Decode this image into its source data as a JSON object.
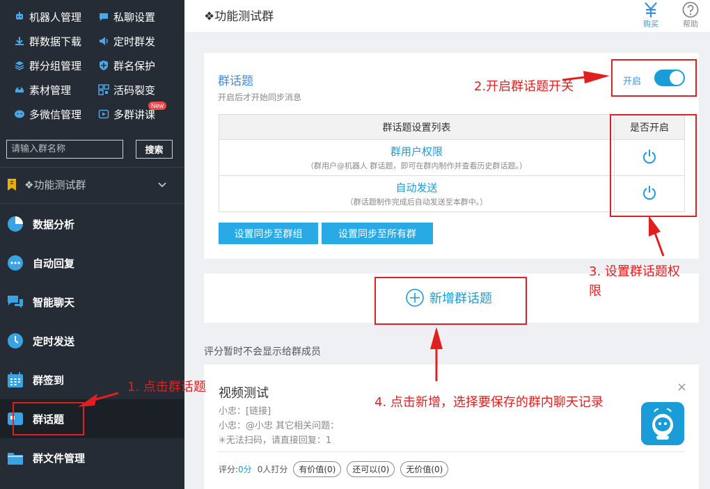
{
  "top_menu": {
    "items": [
      {
        "label": "机器人管理",
        "icon": "robot-icon"
      },
      {
        "label": "私聊设置",
        "icon": "chat-icon"
      },
      {
        "label": "群数据下载",
        "icon": "download-icon"
      },
      {
        "label": "定时群发",
        "icon": "broadcast-icon"
      },
      {
        "label": "群分组管理",
        "icon": "layers-icon"
      },
      {
        "label": "群名保护",
        "icon": "shield-icon"
      },
      {
        "label": "素材管理",
        "icon": "material-icon"
      },
      {
        "label": "活码裂变",
        "icon": "qrcode-icon"
      },
      {
        "label": "多微信管理",
        "icon": "wechat-icon"
      },
      {
        "label": "多群讲课",
        "icon": "play-icon"
      }
    ],
    "new_badge": "New"
  },
  "search": {
    "placeholder": "请输入群名称",
    "button": "搜索"
  },
  "group_selector": {
    "name": "❖功能测试群"
  },
  "nav": {
    "items": [
      {
        "label": "数据分析",
        "icon": "pie-chart-icon"
      },
      {
        "label": "自动回复",
        "icon": "message-dots-icon"
      },
      {
        "label": "智能聊天",
        "icon": "chat-bubbles-icon"
      },
      {
        "label": "定时发送",
        "icon": "clock-icon"
      },
      {
        "label": "群签到",
        "icon": "calendar-icon"
      },
      {
        "label": "群话题",
        "icon": "topic-icon"
      },
      {
        "label": "群文件管理",
        "icon": "folder-icon"
      }
    ],
    "active": "群话题"
  },
  "header": {
    "title": "❖功能测试群",
    "buy_label": "购买",
    "help_label": "帮助"
  },
  "topic_settings": {
    "title": "群话题",
    "subtitle": "开启后才开始同步消息",
    "toggle_label": "开启",
    "toggle_on": true,
    "table": {
      "col1": "群话题设置列表",
      "col2": "是否开启",
      "rows": [
        {
          "name": "群用户权限",
          "desc": "（群用户@机器人 群话题，即可在群内制作并查看历史群话题。）"
        },
        {
          "name": "自动发送",
          "desc": "（群话题制作完成后自动发送至本群中。）"
        }
      ]
    },
    "sync_group_btn": "设置同步至群组",
    "sync_all_btn": "设置同步至所有群"
  },
  "add_topic": {
    "label": "新增群话题"
  },
  "score_note": "评分暂时不会显示给群成员",
  "topic_card": {
    "title": "视频测试",
    "lines": [
      "小忠：[链接]",
      "小忠：@小忠 其它相关问题：",
      "✳无法扫码，请直接回复：1"
    ],
    "score_label": "评分:",
    "score_value": "0分",
    "raters": "0人打分",
    "ratings": [
      "有价值(0)",
      "还可以(0)",
      "无价值(0)"
    ],
    "close": "×"
  },
  "annotations": {
    "step1": "1. 点击群话题",
    "step2": "2.开启群话题开关",
    "step3a": "3. 设置群话题权",
    "step3b": "限",
    "step4": "4. 点击新增，选择要保存的群内聊天记录"
  },
  "colors": {
    "accent": "#1a9cd6",
    "sidebar": "#262c35",
    "annotation": "#e02020"
  }
}
